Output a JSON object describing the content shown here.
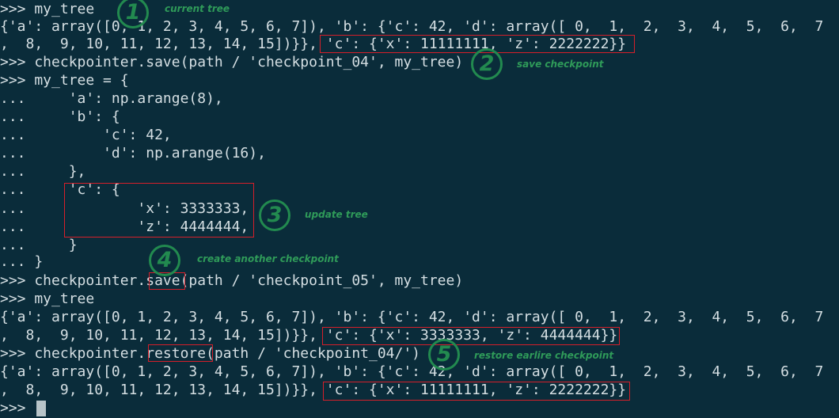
{
  "terminal": {
    "lines": [
      ">>> my_tree",
      "{'a': array([0, 1, 2, 3, 4, 5, 6, 7]), 'b': {'c': 42, 'd': array([ 0,  1,  2,  3,  4,  5,  6,  7",
      ",  8,  9, 10, 11, 12, 13, 14, 15])}}, 'c': {'x': 11111111, 'z': 2222222}}",
      ">>> checkpointer.save(path / 'checkpoint_04', my_tree)",
      ">>> my_tree = {",
      "...     'a': np.arange(8),",
      "...     'b': {",
      "...         'c': 42,",
      "...         'd': np.arange(16),",
      "...     },",
      "...     'c': {",
      "...             'x': 3333333,",
      "...             'z': 4444444,",
      "...     }",
      "... }",
      ">>> checkpointer.save(path / 'checkpoint_05', my_tree)",
      ">>> my_tree",
      "{'a': array([0, 1, 2, 3, 4, 5, 6, 7]), 'b': {'c': 42, 'd': array([ 0,  1,  2,  3,  4,  5,  6,  7",
      ",  8,  9, 10, 11, 12, 13, 14, 15])}}, 'c': {'x': 3333333, 'z': 4444444}}",
      ">>> checkpointer.restore(path / 'checkpoint_04/')",
      "{'a': array([0, 1, 2, 3, 4, 5, 6, 7]), 'b': {'c': 42, 'd': array([ 0,  1,  2,  3,  4,  5,  6,  7",
      ",  8,  9, 10, 11, 12, 13, 14, 15])}}, 'c': {'x': 11111111, 'z': 2222222}}",
      ">>> "
    ]
  },
  "annotations": [
    {
      "number": "1",
      "label": "current tree"
    },
    {
      "number": "2",
      "label": "save checkpoint"
    },
    {
      "number": "3",
      "label": "update tree"
    },
    {
      "number": "4",
      "label": "create another checkpoint"
    },
    {
      "number": "5",
      "label": "restore earlire checkpoint"
    }
  ],
  "colors": {
    "background": "#0a2c3a",
    "text": "#d5dfe3",
    "highlight_box": "#d61f2a",
    "annotation": "#228a4f"
  }
}
